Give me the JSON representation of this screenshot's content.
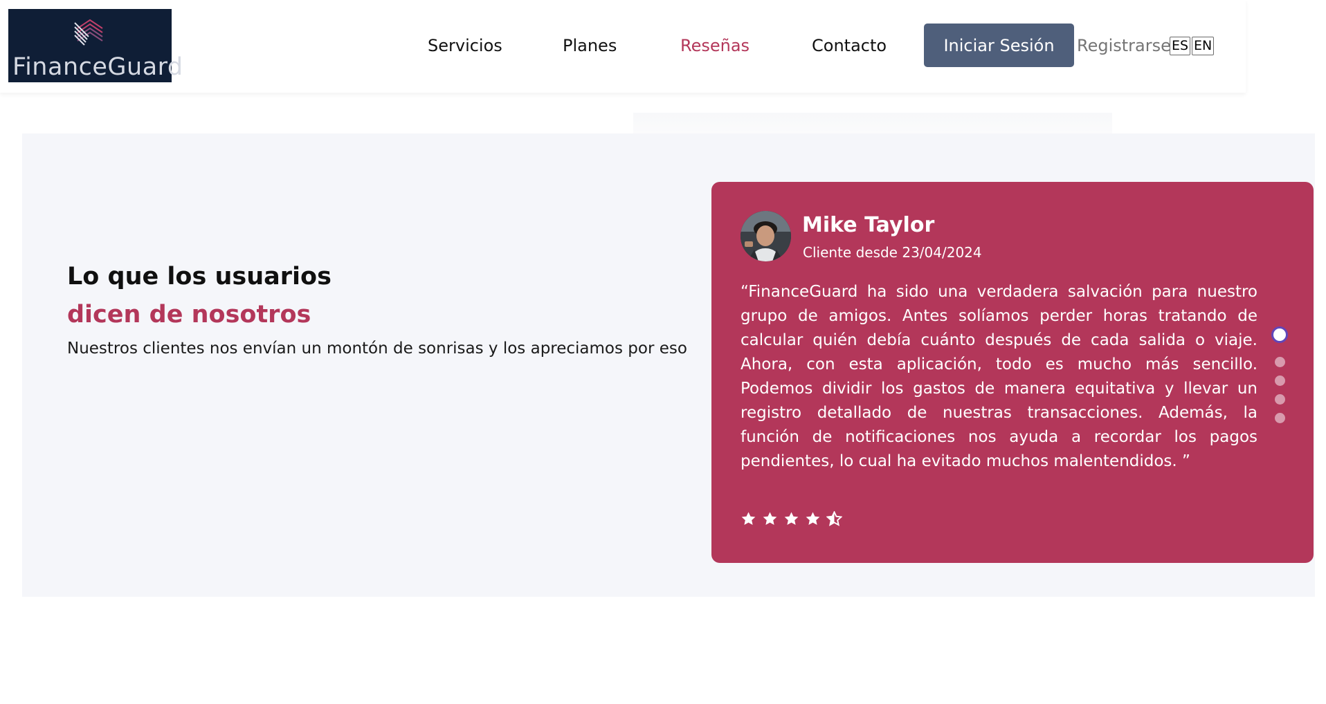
{
  "brand": {
    "name": "FinanceGuard"
  },
  "nav": {
    "items": [
      {
        "label": "Servicios"
      },
      {
        "label": "Planes"
      },
      {
        "label": "Reseñas",
        "active": true
      },
      {
        "label": "Contacto"
      }
    ],
    "login_label": "Iniciar Sesión",
    "register_label": "Registrarse",
    "languages": [
      "ES",
      "EN"
    ]
  },
  "testimonials": {
    "heading_line1": "Lo que los usuarios",
    "heading_line2": "dicen de nosotros",
    "subtitle": "Nuestros clientes nos envían un montón de sonrisas y los apreciamos por eso",
    "review": {
      "name": "Mike Taylor",
      "since": "Cliente desde 23/04/2024",
      "text": "“FinanceGuard ha sido una verdadera salvación para nuestro grupo de amigos. Antes solíamos perder horas tratando de calcular quién debía cuánto después de cada salida o viaje. Ahora, con esta aplicación, todo es mucho más sencillo. Podemos dividir los gastos de manera equitativa y llevar un registro detallado de nuestras transacciones. Además, la función de notificaciones nos ayuda a recordar los pagos pendientes, lo cual ha evitado muchos malentendidos. ”",
      "rating": 4.5,
      "rating_max": 5
    },
    "carousel": {
      "total": 5,
      "active_index": 1
    }
  },
  "colors": {
    "accent": "#b3375a",
    "button": "#4f5f7b",
    "logo_bg": "#0f1e36",
    "section_bg": "#f5f6fa"
  }
}
